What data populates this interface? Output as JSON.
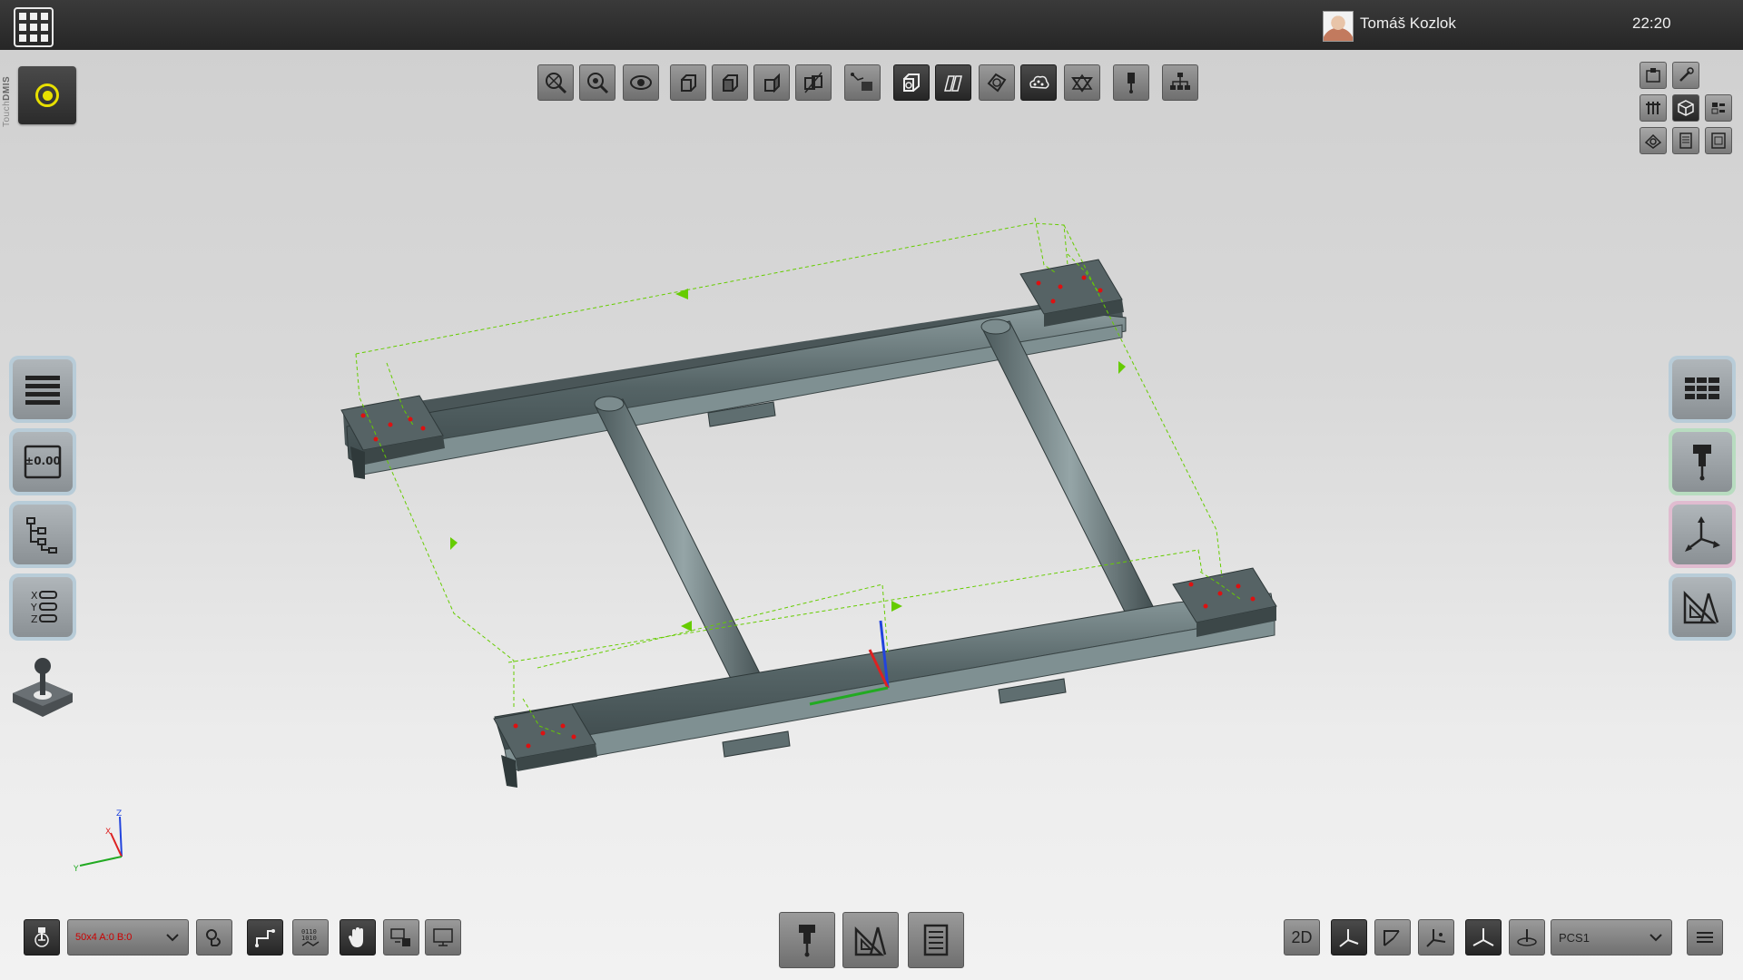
{
  "topbar": {
    "user_name": "Tomáš Kozlok",
    "time": "22:20"
  },
  "brand": {
    "prefix": "Touch",
    "suffix": "DMIS"
  },
  "colors": {
    "record_accent": "#e8e000",
    "path_line": "#66cc00",
    "probe_point": "#dd1111",
    "axis_x": "#dd2222",
    "axis_y": "#22aa22",
    "axis_z": "#2244dd",
    "part_body": "#5f6e70"
  },
  "top_toolbar": [
    {
      "icon": "zoom-fit-icon"
    },
    {
      "icon": "zoom-window-icon"
    },
    {
      "icon": "view-eye-icon"
    },
    {
      "icon": "view-iso-icon"
    },
    {
      "icon": "view-front-icon"
    },
    {
      "icon": "view-side-icon"
    },
    {
      "icon": "view-section-icon"
    },
    {
      "icon": "probe-path-icon"
    },
    {
      "icon": "solid-view-icon"
    },
    {
      "icon": "wireframe-view-icon"
    },
    {
      "icon": "transparent-view-icon"
    },
    {
      "icon": "point-cloud-icon"
    },
    {
      "icon": "shaded-edges-icon"
    },
    {
      "icon": "probe-icon"
    },
    {
      "icon": "program-tree-icon"
    }
  ],
  "right_panel": [
    {
      "icon": "machine-icon"
    },
    {
      "icon": "wrench-icon"
    },
    {
      "icon": "tools-icon"
    },
    {
      "icon": "cube-icon"
    },
    {
      "icon": "layout-icon"
    },
    {
      "icon": "cad-model-icon"
    },
    {
      "icon": "list-icon"
    },
    {
      "icon": "report-icon"
    }
  ],
  "left_sidebar": [
    {
      "icon": "menu-lines-icon"
    },
    {
      "icon": "tolerance-icon"
    },
    {
      "icon": "hierarchy-icon"
    },
    {
      "icon": "xyz-readout-icon"
    }
  ],
  "tolerance_label": "±0.00",
  "xyz_labels": {
    "x": "X",
    "y": "Y",
    "z": "Z"
  },
  "right_sidebar": [
    {
      "icon": "table-icon"
    },
    {
      "icon": "probe-tool-icon"
    },
    {
      "icon": "coordinate-system-icon"
    },
    {
      "icon": "construct-icon"
    }
  ],
  "triad": {
    "x": "X",
    "y": "Y",
    "z": "Z"
  },
  "bottom_left": {
    "probe_select_value": "50x4 A:0 B:0"
  },
  "bottom_center": [
    {
      "icon": "probe-tool-icon"
    },
    {
      "icon": "construct-icon"
    },
    {
      "icon": "report-icon"
    }
  ],
  "bottom_right": {
    "view_2d_label": "2D",
    "coord_system_value": "PCS1"
  }
}
